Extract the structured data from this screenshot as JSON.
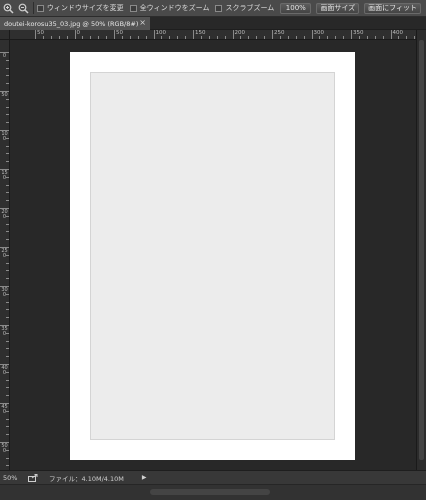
{
  "options_bar": {
    "tools": [
      {
        "name": "zoom-in-icon"
      },
      {
        "name": "zoom-out-icon"
      }
    ],
    "checkboxes": [
      {
        "label": "ウィンドウサイズを変更",
        "checked": false
      },
      {
        "label": "全ウィンドウをズーム",
        "checked": false
      },
      {
        "label": "スクラブズーム",
        "checked": false
      }
    ],
    "buttons": {
      "actual_pixels": "100%",
      "fit_screen": "画面サイズ",
      "fill_screen": "画面にフィット"
    }
  },
  "document_tab": {
    "title": "doutei-korosu35_03.jpg @ 50% (RGB/8#)",
    "close_glyph": "×"
  },
  "ruler_h": {
    "labels": [
      "50",
      "0",
      "50",
      "100",
      "150",
      "200",
      "250",
      "300",
      "350",
      "400"
    ]
  },
  "ruler_v": {
    "labels": [
      "0",
      "50",
      "100",
      "150",
      "200",
      "250",
      "300",
      "350",
      "400",
      "450",
      "500",
      "550"
    ]
  },
  "status_bar": {
    "zoom": "50%",
    "file_info": "ファイル：4.10M/4.10M",
    "arrow": "▶"
  }
}
